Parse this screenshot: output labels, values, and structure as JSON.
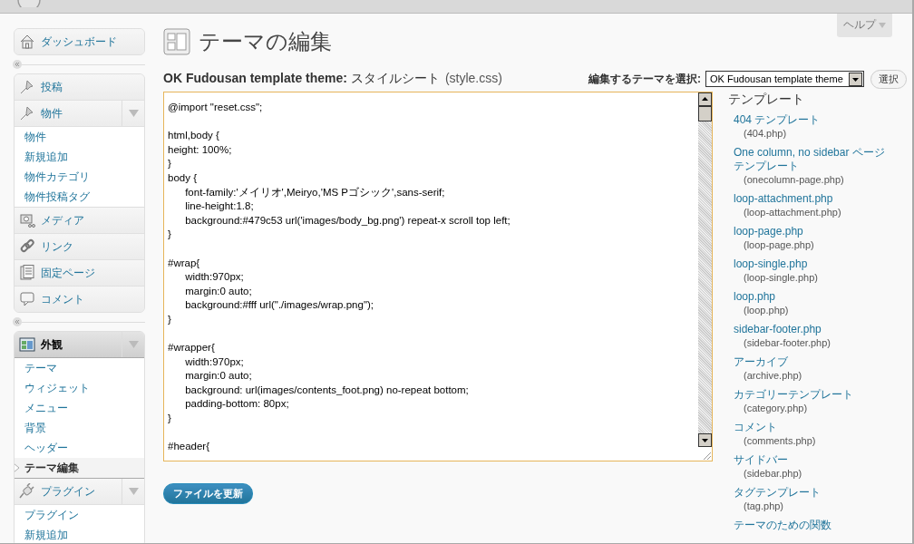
{
  "help_tab": {
    "label": "ヘルプ"
  },
  "menu_groups": [
    [
      {
        "label": "ダッシュボード",
        "expanded": false,
        "current": false
      }
    ],
    [
      {
        "label": "投稿",
        "expanded": false,
        "current": false
      },
      {
        "label": "物件",
        "expanded": true,
        "current": false,
        "children": [
          {
            "label": "物件",
            "selected": false
          },
          {
            "label": "新規追加",
            "selected": false
          },
          {
            "label": "物件カテゴリ",
            "selected": false
          },
          {
            "label": "物件投稿タグ",
            "selected": false
          }
        ]
      },
      {
        "label": "メディア",
        "expanded": false,
        "current": false
      },
      {
        "label": "リンク",
        "expanded": false,
        "current": false
      },
      {
        "label": "固定ページ",
        "expanded": false,
        "current": false
      },
      {
        "label": "コメント",
        "expanded": false,
        "current": false
      }
    ],
    [
      {
        "label": "外観",
        "expanded": true,
        "current": true,
        "children": [
          {
            "label": "テーマ",
            "selected": false
          },
          {
            "label": "ウィジェット",
            "selected": false
          },
          {
            "label": "メニュー",
            "selected": false
          },
          {
            "label": "背景",
            "selected": false
          },
          {
            "label": "ヘッダー",
            "selected": false
          },
          {
            "label": "テーマ編集",
            "selected": true
          }
        ]
      },
      {
        "label": "プラグイン",
        "expanded": true,
        "current": false,
        "children": [
          {
            "label": "プラグイン",
            "selected": false
          },
          {
            "label": "新規追加",
            "selected": false
          }
        ]
      }
    ]
  ],
  "page_title": "テーマの編集",
  "file_heading": "**OK Fudousan template theme:** スタイルシート",
  "file_name": "(style.css)",
  "theme_select": {
    "label": "編集するテーマを選択:",
    "value": "OK Fudousan template theme",
    "button": "選択"
  },
  "code_lines": [
    {
      "text": "@import \"reset.css\";",
      "gap_before": false
    },
    {
      "text": "html,body {",
      "gap_before": true
    },
    {
      "text": "height: 100%;",
      "gap_before": false
    },
    {
      "text": "}",
      "gap_before": false
    },
    {
      "text": "body {",
      "gap_before": false
    },
    {
      "text": "\tfont-family:'メイリオ',Meiryo,'MS Pゴシック',sans-serif;",
      "gap_before": false
    },
    {
      "text": "\tline-height:1.8;",
      "gap_before": false
    },
    {
      "text": "\tbackground:#479c53 url('images/body_bg.png') repeat-x scroll top left;",
      "gap_before": false
    },
    {
      "text": "}",
      "gap_before": false
    },
    {
      "text": "#wrap{",
      "gap_before": true
    },
    {
      "text": "\twidth:970px;",
      "gap_before": false
    },
    {
      "text": "\tmargin:0 auto;",
      "gap_before": false
    },
    {
      "text": "\tbackground:#fff url(\"./images/wrap.png\");",
      "gap_before": false
    },
    {
      "text": "}",
      "gap_before": false
    },
    {
      "text": "#wrapper{",
      "gap_before": true
    },
    {
      "text": "\twidth:970px;",
      "gap_before": false
    },
    {
      "text": "\tmargin:0 auto;",
      "gap_before": false
    },
    {
      "text": "\tbackground: url(images/contents_foot.png) no-repeat bottom;",
      "gap_before": false
    },
    {
      "text": "\tpadding-bottom: 80px;",
      "gap_before": false
    },
    {
      "text": "}",
      "gap_before": false
    },
    {
      "text": "#header{",
      "gap_before": true
    }
  ],
  "update_button": "ファイルを更新",
  "templates": {
    "heading": "テンプレート",
    "items": [
      {
        "name": "404 テンプレート",
        "file": "(404.php)"
      },
      {
        "name": "One column, no sidebar ページテンプレート",
        "file": "(onecolumn-page.php)"
      },
      {
        "name": "loop-attachment.php",
        "file": "(loop-attachment.php)"
      },
      {
        "name": "loop-page.php",
        "file": "(loop-page.php)"
      },
      {
        "name": "loop-single.php",
        "file": "(loop-single.php)"
      },
      {
        "name": "loop.php",
        "file": "(loop.php)"
      },
      {
        "name": "sidebar-footer.php",
        "file": "(sidebar-footer.php)"
      },
      {
        "name": "アーカイブ",
        "file": "(archive.php)"
      },
      {
        "name": "カテゴリーテンプレート",
        "file": "(category.php)"
      },
      {
        "name": "コメント",
        "file": "(comments.php)"
      },
      {
        "name": "サイドバー",
        "file": "(sidebar.php)"
      },
      {
        "name": "タグテンプレート",
        "file": "(tag.php)"
      },
      {
        "name": "テーマのための関数"
      }
    ]
  }
}
